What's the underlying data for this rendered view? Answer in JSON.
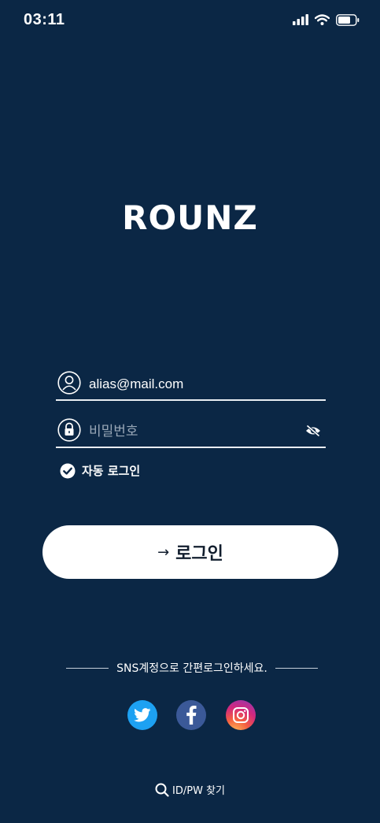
{
  "status_bar": {
    "time": "03:11",
    "icons": [
      "signal-icon",
      "wifi-icon",
      "battery-icon"
    ]
  },
  "app": {
    "logo_text": "ROUNZ"
  },
  "login_form": {
    "email": {
      "value": "alias@mail.com",
      "icon": "user-icon"
    },
    "password": {
      "placeholder": "비밀번호",
      "icon": "lock-icon",
      "toggle_icon": "eye-off-icon"
    },
    "auto_login": {
      "label": "자동 로그인",
      "checked": true
    },
    "submit": {
      "arrow": "→",
      "label": "로그인"
    }
  },
  "sns": {
    "prompt": "SNS계정으로 간편로그인하세요.",
    "providers": [
      "twitter-icon",
      "facebook-icon",
      "instagram-icon"
    ]
  },
  "footer": {
    "find_label": "ID/PW 찾기",
    "find_icon": "search-icon"
  },
  "colors": {
    "background": "#0b2745",
    "button_bg": "#ffffff",
    "button_text": "#111d2d",
    "twitter": "#1da1f2",
    "facebook": "#3b5998"
  }
}
